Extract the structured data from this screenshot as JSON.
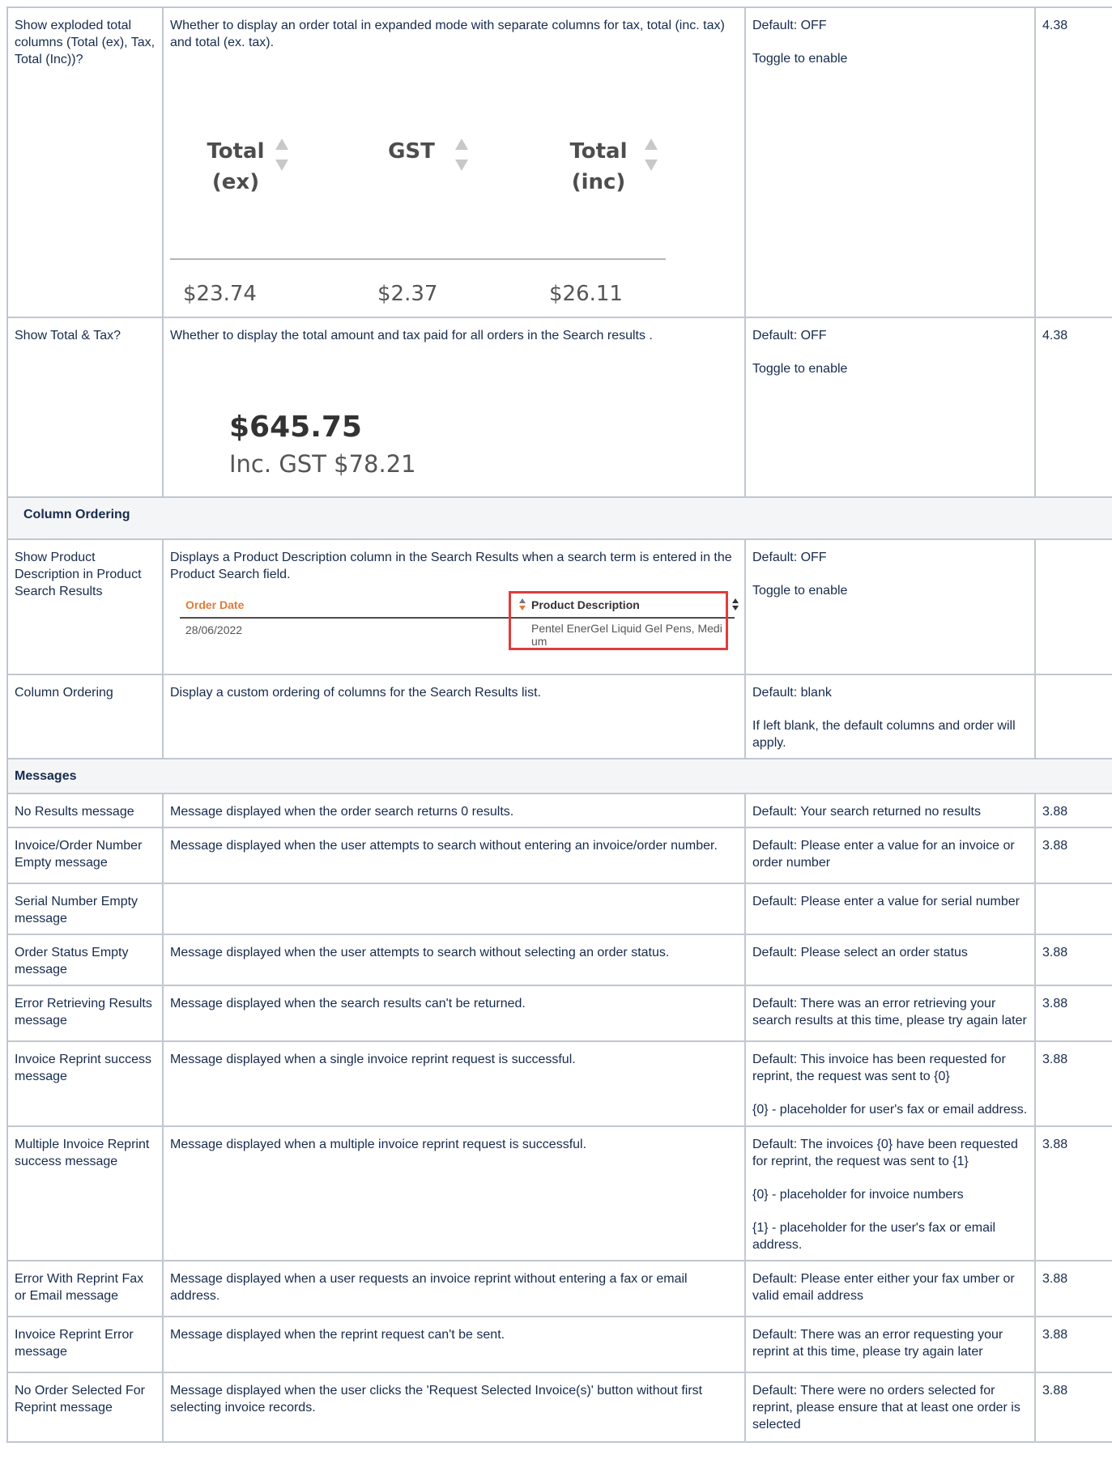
{
  "rows": {
    "exploded": {
      "name": "Show exploded total columns (Total (ex), Tax, Total (Inc))?",
      "description": "Whether to display an order total in expanded mode with separate columns for tax, total (inc. tax) and total (ex. tax).",
      "default": "Default: OFF",
      "note": "Toggle to enable",
      "version": "4.38",
      "image": {
        "col1_line1": "Total",
        "col1_line2": "(ex)",
        "col2": "GST",
        "col3_line1": "Total",
        "col3_line2": "(inc)",
        "val1": "$23.74",
        "val2": "$2.37",
        "val3": "$26.11"
      }
    },
    "total_tax": {
      "name": "Show Total & Tax?",
      "description": "Whether to display the total amount and tax paid for all orders in the Search results .",
      "default": "Default: OFF",
      "note": "Toggle to enable",
      "version": "4.38",
      "image": {
        "total": "$645.75",
        "tax": "Inc. GST $78.21"
      }
    },
    "section_column_ordering": "Column Ordering",
    "product_desc": {
      "name": "Show Product Description in Product Search Results",
      "description": "Displays a Product Description column in the Search Results  when a search term is entered in the Product Search field.",
      "default": "Default: OFF",
      "note": "Toggle to enable",
      "version": "",
      "image": {
        "col1_header": "Order Date",
        "col2_header": "Product Description",
        "date": "28/06/2022",
        "product": "Pentel EnerGel Liquid Gel Pens, Medium"
      }
    },
    "column_ordering": {
      "name": "Column Ordering",
      "description": "Display a custom ordering of columns for the Search Results list.",
      "default": "Default: blank",
      "note": "If left blank, the default columns and order will apply.",
      "version": ""
    },
    "section_messages": "Messages",
    "messages": [
      {
        "name": "No Results message",
        "description": "Message displayed when the order search returns 0 results.",
        "default": [
          "Default: Your search returned no results"
        ],
        "version": "3.88"
      },
      {
        "name": "Invoice/Order Number Empty message",
        "description": "Message displayed when the user attempts to search without entering an invoice/order number.",
        "default": [
          "Default: Please enter a value for an invoice or order number"
        ],
        "version": "3.88"
      },
      {
        "name": "Serial Number Empty message",
        "description": "",
        "default": [
          "Default: Please enter a value for serial number"
        ],
        "version": ""
      },
      {
        "name": "Order Status Empty message",
        "description": "Message displayed when the user attempts to search without selecting an order status.",
        "default": [
          "Default: Please select an order status"
        ],
        "version": "3.88"
      },
      {
        "name": "Error Retrieving Results message",
        "description": "Message displayed when the search results can't be returned.",
        "default": [
          "Default: There was an error retrieving your search results at this time, please try again later"
        ],
        "version": "3.88"
      },
      {
        "name": "Invoice Reprint success message",
        "description": "Message displayed when a single invoice reprint request is successful.",
        "default": [
          "Default: This invoice has been requested for reprint, the request was sent to {0}",
          "{0} - placeholder for user's fax or email address."
        ],
        "version": "3.88"
      },
      {
        "name": "Multiple Invoice Reprint success message",
        "description": "Message displayed when a multiple invoice reprint request is successful.",
        "default": [
          "Default: The invoices {0} have been requested for reprint, the request was sent to {1}",
          "{0} - placeholder for invoice numbers",
          "{1} - placeholder for the user's fax or email address."
        ],
        "version": "3.88"
      },
      {
        "name": "Error With Reprint Fax or Email message",
        "description": "Message displayed when a user requests an invoice reprint without entering a fax or email address.",
        "default": [
          "Default: Please enter either your fax umber or valid email address"
        ],
        "version": "3.88"
      },
      {
        "name": "Invoice Reprint Error message",
        "description": "Message displayed when the reprint request can't be sent.",
        "default": [
          "Default: There was an error requesting your reprint at this time, please try again later"
        ],
        "version": "3.88"
      },
      {
        "name": "No Order Selected For Reprint message",
        "description": "Message displayed when the user clicks the 'Request Selected Invoice(s)' button without first selecting invoice records.",
        "default": [
          "Default: There were no orders selected for reprint, please ensure that at least one order is selected"
        ],
        "version": "3.88"
      }
    ]
  }
}
